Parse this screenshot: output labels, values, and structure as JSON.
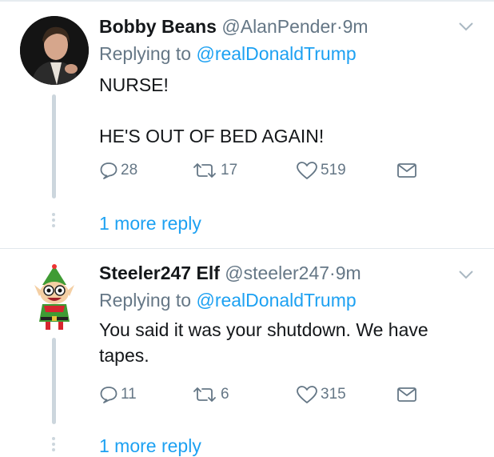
{
  "tweets": [
    {
      "display_name": "Bobby Beans",
      "handle": "@AlanPender",
      "separator": "·",
      "time": "9m",
      "replying_prefix": "Replying to",
      "replying_to": "@realDonaldTrump",
      "text_lines": [
        "NURSE!",
        "HE'S OUT OF BED AGAIN!"
      ],
      "reply_count": "28",
      "retweet_count": "17",
      "like_count": "519",
      "more_replies": "1 more reply"
    },
    {
      "display_name": "Steeler247 Elf",
      "handle": "@steeler247",
      "separator": "·",
      "time": "9m",
      "replying_prefix": "Replying to",
      "replying_to": "@realDonaldTrump",
      "text_lines": [
        "You said it was your shutdown. We have",
        "tapes."
      ],
      "reply_count": "11",
      "retweet_count": "6",
      "like_count": "315",
      "more_replies": "1 more reply"
    }
  ],
  "colors": {
    "link": "#1da1f2",
    "muted": "#657786",
    "text": "#14171a",
    "thread": "#ccd6dd"
  },
  "icons": [
    "reply-icon",
    "retweet-icon",
    "like-icon",
    "direct-message-icon",
    "chevron-down-icon"
  ]
}
